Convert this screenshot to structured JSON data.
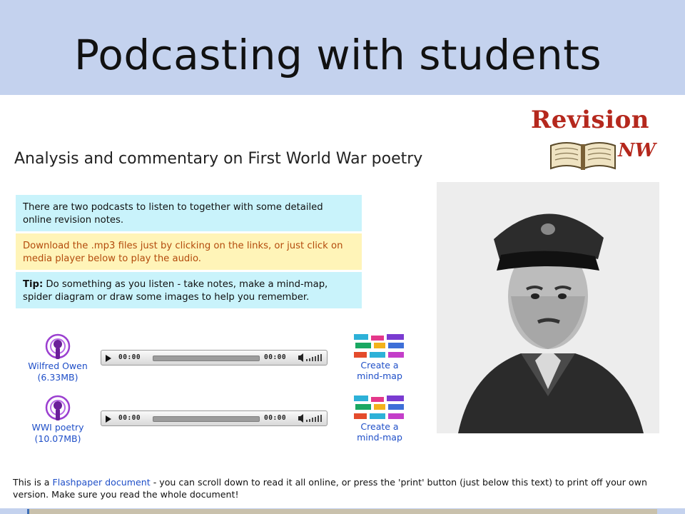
{
  "slide": {
    "title": "Podcasting with students"
  },
  "logo": {
    "word": "Revision",
    "signature": "NW"
  },
  "page": {
    "heading": "Analysis and commentary on First World War poetry",
    "boxes": {
      "intro": "There are two podcasts to listen to together with some detailed online revision notes.",
      "download": "Download the .mp3 files just by clicking on the links, or just click on media player below to play the audio.",
      "tip_label": "Tip:",
      "tip_text": " Do something as you listen - take notes, make a mind-map, spider diagram or draw some images to help you remember."
    },
    "podcasts": [
      {
        "name": "Wilfred Owen",
        "size": "(6.33MB)",
        "time_start": "00:00",
        "time_end": "00:00",
        "mindmap": "Create a mind-map"
      },
      {
        "name": "WWI poetry",
        "size": "(10.07MB)",
        "time_start": "00:00",
        "time_end": "00:00",
        "mindmap": "Create a mind-map"
      }
    ],
    "footer": {
      "before": "This is a ",
      "link": "Flashpaper document",
      "after": " - you can scroll down to read it all online, or press the 'print' button (just below this text) to print off your own version. Make sure you read the whole document!"
    }
  },
  "colors": {
    "title_band": "#c4d2ee",
    "info_blue": "#c9f3fb",
    "info_yellow": "#fff4b8",
    "download_text": "#b34b0c",
    "link_blue": "#1f4fc8",
    "logo_red": "#b5281d"
  }
}
